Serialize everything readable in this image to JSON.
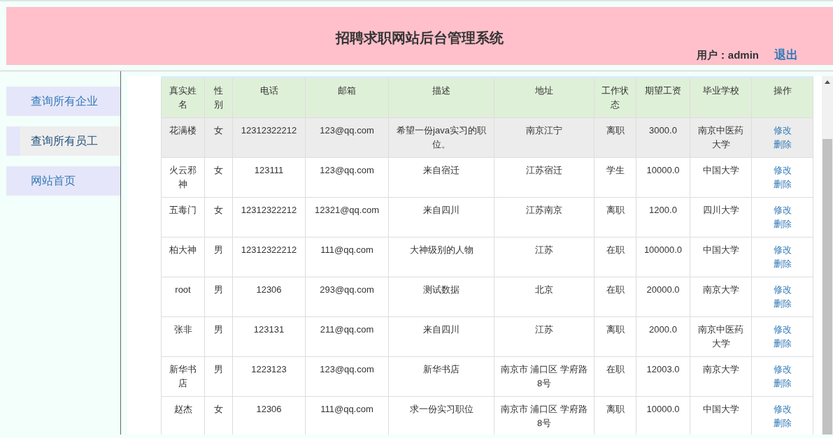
{
  "header": {
    "title": "招聘求职网站后台管理系统",
    "user_label": "用户：admin",
    "logout": "退出"
  },
  "sidebar": {
    "items": [
      {
        "label": "查询所有企业",
        "selected": false
      },
      {
        "label": "查询所有员工",
        "selected": true
      },
      {
        "label": "网站首页",
        "selected": false
      }
    ]
  },
  "table": {
    "columns": [
      "真实姓名",
      "性别",
      "电话",
      "邮箱",
      "描述",
      "地址",
      "工作状态",
      "期望工资",
      "毕业学校",
      "操作"
    ],
    "rows": [
      {
        "hovered": true,
        "cells": [
          "花满楼",
          "女",
          "12312322212",
          "123@qq.com",
          "希望一份java实习的职位。",
          "南京江宁",
          "离职",
          "3000.0",
          "南京中医药大学"
        ],
        "actions": [
          "修改",
          "删除"
        ]
      },
      {
        "hovered": false,
        "cells": [
          "火云邪神",
          "女",
          "123111",
          "123@qq.com",
          "来自宿迁",
          "江苏宿迁",
          "学生",
          "10000.0",
          "中国大学"
        ],
        "actions": [
          "修改",
          "删除"
        ]
      },
      {
        "hovered": false,
        "cells": [
          "五毒门",
          "女",
          "12312322212",
          "12321@qq.com",
          "来自四川",
          "江苏南京",
          "离职",
          "1200.0",
          "四川大学"
        ],
        "actions": [
          "修改",
          "删除"
        ]
      },
      {
        "hovered": false,
        "cells": [
          "柏大神",
          "男",
          "12312322212",
          "111@qq.com",
          "大神级别的人物",
          "江苏",
          "在职",
          "100000.0",
          "中国大学"
        ],
        "actions": [
          "修改",
          "删除"
        ]
      },
      {
        "hovered": false,
        "cells": [
          "root",
          "男",
          "12306",
          "293@qq.com",
          "测试数据",
          "北京",
          "在职",
          "20000.0",
          "南京大学"
        ],
        "actions": [
          "修改",
          "删除"
        ]
      },
      {
        "hovered": false,
        "cells": [
          "张非",
          "男",
          "123131",
          "211@qq.com",
          "来自四川",
          "江苏",
          "离职",
          "2000.0",
          "南京中医药大学"
        ],
        "actions": [
          "修改",
          "删除"
        ]
      },
      {
        "hovered": false,
        "cells": [
          "新华书店",
          "男",
          "1223123",
          "123@qq.com",
          "新华书店",
          "南京市 浦口区 学府路8号",
          "在职",
          "12003.0",
          "南京大学"
        ],
        "actions": [
          "修改",
          "删除"
        ]
      },
      {
        "hovered": false,
        "cells": [
          "赵杰",
          "女",
          "12306",
          "111@qq.com",
          "求一份实习职位",
          "南京市 浦口区 学府路8号",
          "离职",
          "10000.0",
          "中国大学"
        ],
        "actions": [
          "修改",
          "删除"
        ]
      }
    ]
  }
}
